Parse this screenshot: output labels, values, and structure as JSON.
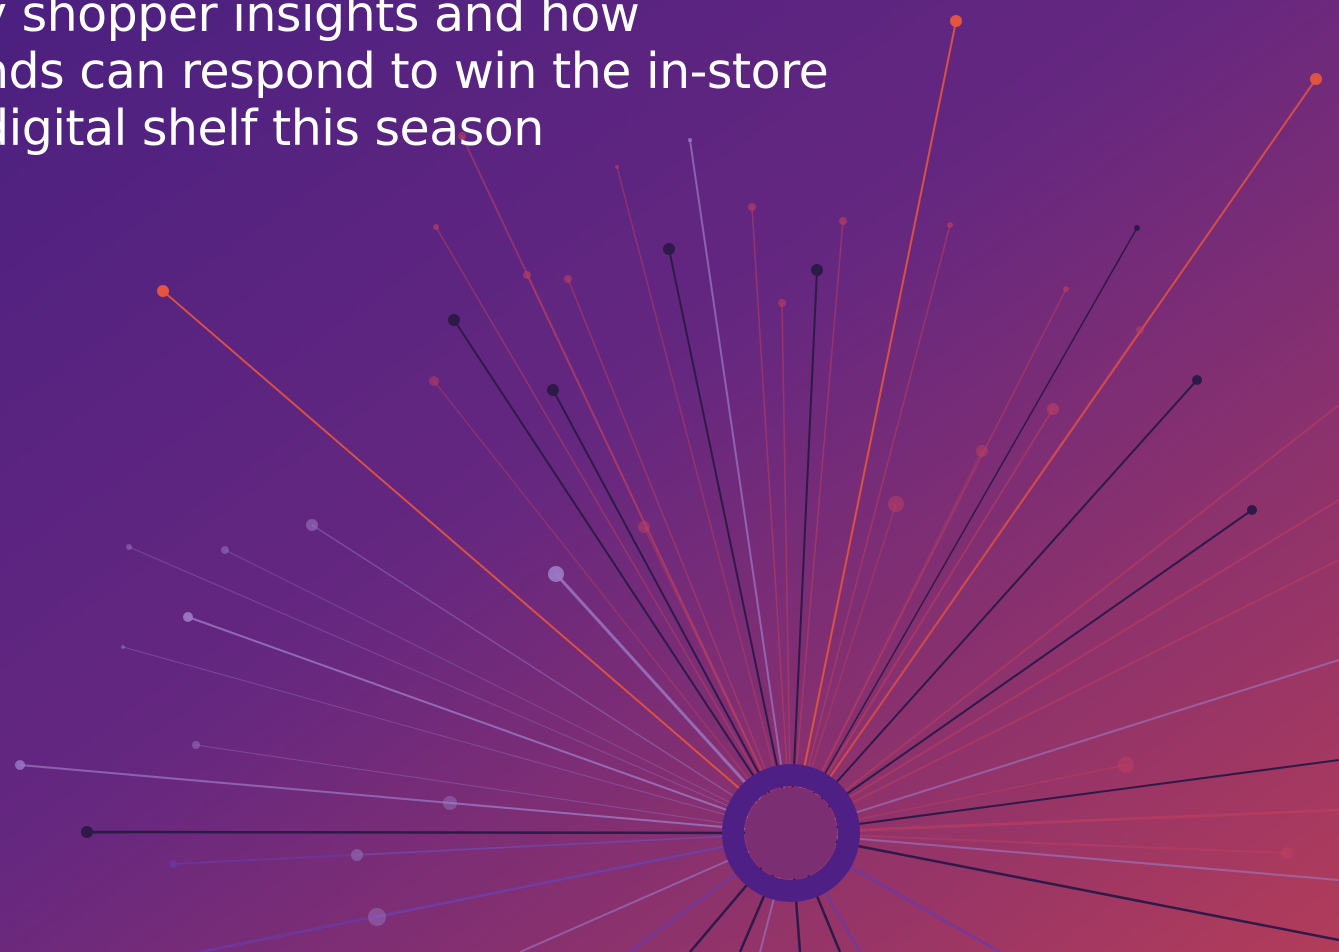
{
  "headline": {
    "lines": [
      "y shopper insights and how",
      "nds can respond to win the in-store",
      "digital shelf this season"
    ]
  },
  "colors": {
    "bg_top_left": "#4c2182",
    "bg_mid": "#6d2a7e",
    "bg_bottom_right": "#b03b5c",
    "hub_ring": "#4e1f85",
    "hub_fill": "#7b2f72",
    "ray_dark": "#2e1a48",
    "ray_orange": "#e4553f",
    "ray_pink": "#c2405f",
    "ray_lavender": "#9c7bc6",
    "ray_violet": "#6a3aa6"
  },
  "decor": {
    "icon": "starburst-network-graphic"
  }
}
